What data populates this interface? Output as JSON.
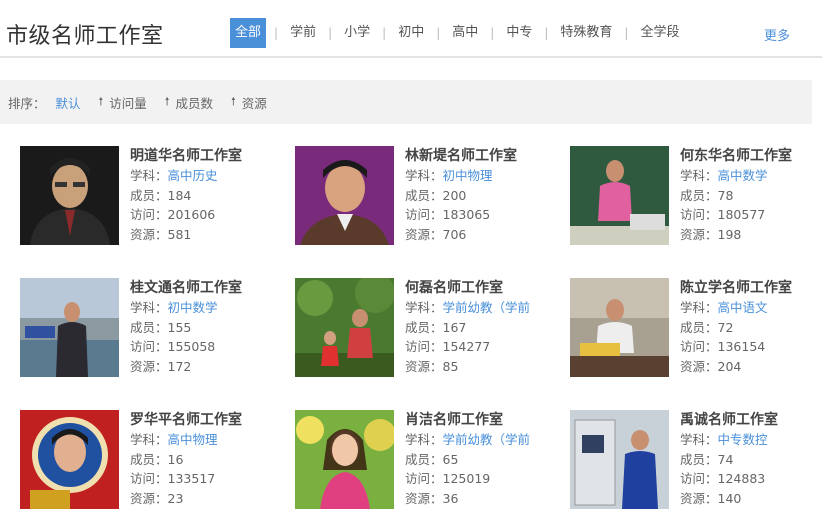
{
  "header": {
    "title": "市级名师工作室",
    "tabs": [
      "全部",
      "学前",
      "小学",
      "初中",
      "高中",
      "中专",
      "特殊教育",
      "全学段"
    ],
    "active_tab": "全部",
    "more_label": "更多"
  },
  "sortbar": {
    "label": "排序：",
    "items": [
      "默认",
      "访问量",
      "成员数",
      "资源"
    ],
    "active": "默认"
  },
  "labels": {
    "subject": "学科：",
    "members": "成员：",
    "visits": "访问：",
    "resources": "资源："
  },
  "studios": [
    {
      "name": "明道华名师工作室",
      "subject": "高中历史",
      "members": "184",
      "visits": "201606",
      "resources": "581"
    },
    {
      "name": "林新堤名师工作室",
      "subject": "初中物理",
      "members": "200",
      "visits": "183065",
      "resources": "706"
    },
    {
      "name": "何东华名师工作室",
      "subject": "高中数学",
      "members": "78",
      "visits": "180577",
      "resources": "198"
    },
    {
      "name": "桂文通名师工作室",
      "subject": "初中数学",
      "members": "155",
      "visits": "155058",
      "resources": "172"
    },
    {
      "name": "何磊名师工作室",
      "subject": "学前幼教（学前",
      "members": "167",
      "visits": "154277",
      "resources": "85"
    },
    {
      "name": "陈立学名师工作室",
      "subject": "高中语文",
      "members": "72",
      "visits": "136154",
      "resources": "204"
    },
    {
      "name": "罗华平名师工作室",
      "subject": "高中物理",
      "members": "16",
      "visits": "133517",
      "resources": "23"
    },
    {
      "name": "肖洁名师工作室",
      "subject": "学前幼教（学前",
      "members": "65",
      "visits": "125019",
      "resources": "36"
    },
    {
      "name": "禹诚名师工作室",
      "subject": "中专数控",
      "members": "74",
      "visits": "124883",
      "resources": "140"
    }
  ],
  "colors": {
    "accent": "#4a90d9",
    "sortbar_bg": "#f2f2f2"
  }
}
